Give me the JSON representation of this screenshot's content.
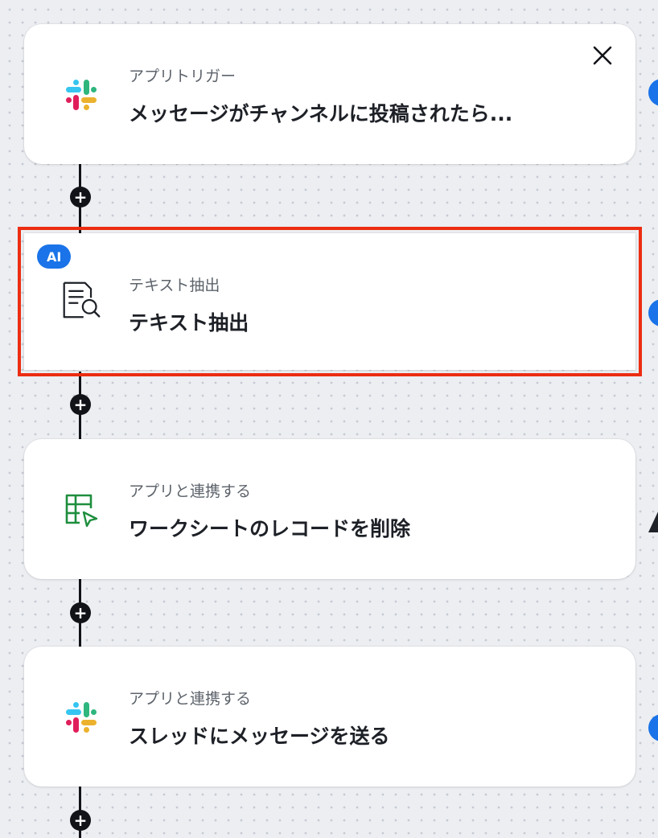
{
  "steps": [
    {
      "type": "app-trigger",
      "icon": "slack-icon",
      "subtitle": "アプリトリガー",
      "title": "メッセージがチャンネルに投稿されたら..."
    },
    {
      "type": "ai-operation",
      "icon": "text-extract-icon",
      "badge": "AI",
      "subtitle": "テキスト抽出",
      "title": "テキスト抽出",
      "selected": true
    },
    {
      "type": "app-action",
      "icon": "spreadsheet-icon",
      "subtitle": "アプリと連携する",
      "title": "ワークシートのレコードを削除"
    },
    {
      "type": "app-action",
      "icon": "slack-icon",
      "subtitle": "アプリと連携する",
      "title": "スレッドにメッセージを送る"
    }
  ],
  "icons": {
    "close": "close-icon",
    "add": "plus-icon",
    "add_label": "+"
  },
  "colors": {
    "selection": "#ec2d11",
    "accent": "#1a73e8",
    "connector": "#111318",
    "sheets_green": "#1e8e3e",
    "slack_blue": "#36c5f0",
    "slack_green": "#2eb67d",
    "slack_yellow": "#ecb22e",
    "slack_red": "#e01e5a"
  }
}
